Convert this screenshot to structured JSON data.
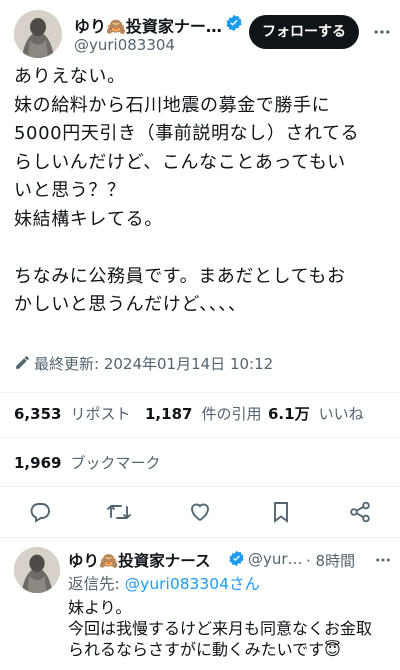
{
  "tweet": {
    "author_name": "ゆり🙈投資家ナー…",
    "handle": "@yuri083304",
    "follow_label": "フォローする",
    "lines": [
      "ありえない。",
      "妹の給料から石川地震の募金で勝手に",
      "5000円天引き（事前説明なし）されてる",
      "らしいんだけど、こんなことあってもい",
      "いと思う？？",
      "妹結構キレてる。",
      "",
      "ちなみに公務員です。まあだとしてもお",
      "かしいと思うんだけど、、、、"
    ],
    "updated": "最終更新: 2024年01月14日 10:12",
    "stats": {
      "reposts_num": "6,353",
      "reposts_label": "リポスト",
      "quotes_num": "1,187",
      "quotes_label": "件の引用",
      "likes_num": "6.1万",
      "likes_label": "いいね",
      "bookmarks_num": "1,969",
      "bookmarks_label": "ブックマーク"
    }
  },
  "reply": {
    "author_name": "ゆり🙈投資家ナース",
    "handle": "@yur…",
    "time": "· 8時間",
    "replying_to_prefix": "返信先: ",
    "replying_to_handle": "@yuri083304さん",
    "lines": [
      "妹より。",
      "今回は我慢するけど来月も同意なくお金取",
      "られるならさすがに動くみたいです😇"
    ]
  },
  "colors": {
    "accent": "#1d9bf0",
    "muted": "#536471",
    "text": "#0f1419"
  },
  "icons": [
    "verified-badge-icon",
    "pencil-icon",
    "reply-icon",
    "repost-icon",
    "like-icon",
    "bookmark-icon",
    "share-icon",
    "more-icon"
  ]
}
